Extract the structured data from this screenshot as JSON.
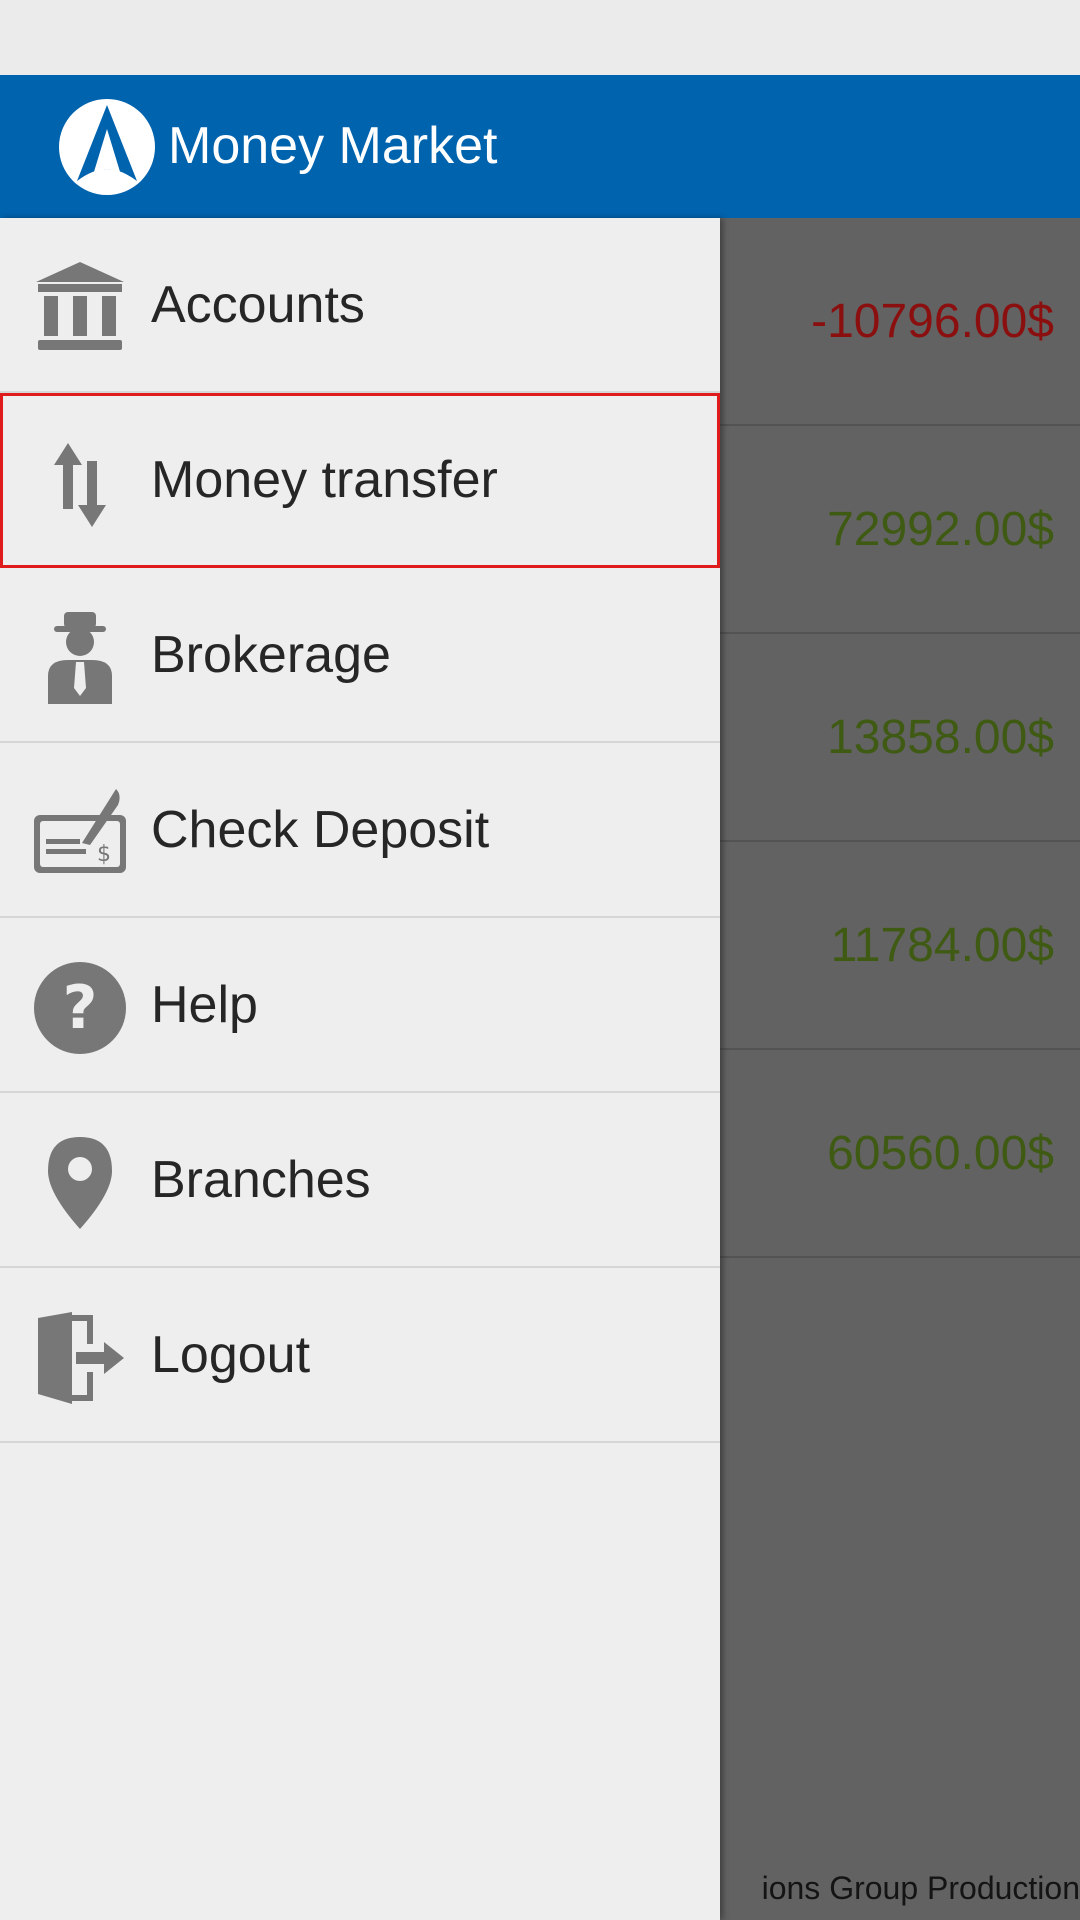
{
  "app_bar": {
    "title": "Money Market",
    "color": "#0063ae",
    "menu_icon": "hamburger-menu-icon",
    "logo_icon": "money-market-logo"
  },
  "drawer": {
    "items": [
      {
        "label": "Accounts",
        "icon": "bank-icon",
        "selected": false
      },
      {
        "label": "Money transfer",
        "icon": "transfer-arrows-icon",
        "selected": true
      },
      {
        "label": "Brokerage",
        "icon": "broker-person-icon",
        "selected": false
      },
      {
        "label": "Check Deposit",
        "icon": "check-deposit-icon",
        "selected": false
      },
      {
        "label": "Help",
        "icon": "help-icon",
        "selected": false
      },
      {
        "label": "Branches",
        "icon": "location-pin-icon",
        "selected": false
      },
      {
        "label": "Logout",
        "icon": "logout-icon",
        "selected": false
      }
    ],
    "selected_outline_color": "#e01b1b"
  },
  "background_content": {
    "amounts": [
      {
        "value": "-10796.00$",
        "color": "#8b0f0f"
      },
      {
        "value": "72992.00$",
        "color": "#3f5a12"
      },
      {
        "value": "13858.00$",
        "color": "#3f5a12"
      },
      {
        "value": "11784.00$",
        "color": "#3f5a12"
      },
      {
        "value": "60560.00$",
        "color": "#3f5a12"
      }
    ],
    "footer": "ions Group Production"
  }
}
